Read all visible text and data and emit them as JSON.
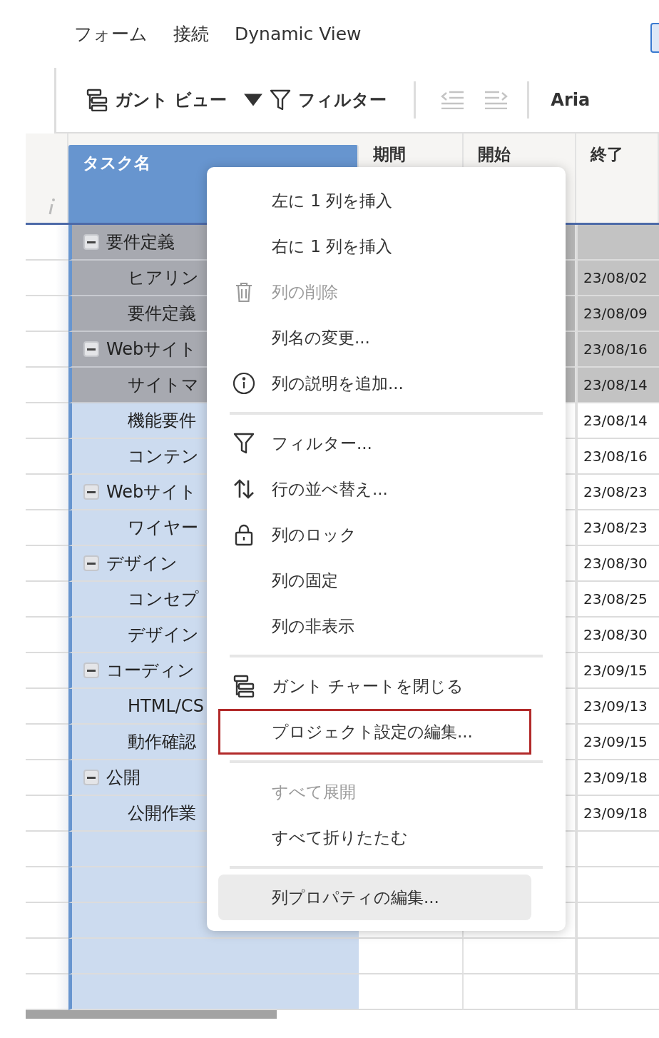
{
  "tabs": [
    {
      "label": "フォーム",
      "selected": false
    },
    {
      "label": "接続",
      "selected": false
    },
    {
      "label": "Dynamic View",
      "selected": false
    }
  ],
  "toolbar": {
    "items": [
      {
        "kind": "view",
        "label": "ガント ビュー"
      },
      {
        "kind": "filter",
        "label": "フィルター"
      },
      {
        "kind": "outdent",
        "disabled": true
      },
      {
        "kind": "indent",
        "disabled": true
      },
      {
        "kind": "font",
        "label": "Aria"
      }
    ]
  },
  "table": {
    "columns": [
      {
        "label": "タスク名",
        "selected": true
      },
      {
        "label": "期間",
        "selected": false
      },
      {
        "label": "開始",
        "selected": false
      },
      {
        "label": "終了",
        "selected": false
      }
    ],
    "rows": [
      {
        "name": "要件定義",
        "selected": true,
        "expanded": true,
        "children": [
          {
            "name": "ヒアリン",
            "end": "23/08/02",
            "selected": true
          },
          {
            "name": "要件定義",
            "end": "23/08/09",
            "selected": true
          }
        ]
      },
      {
        "name": "Webサイト",
        "end": "23/08/16",
        "selected": true,
        "expanded": true,
        "children": [
          {
            "name": "サイトマ",
            "end": "23/08/14",
            "selected": true
          },
          {
            "name": "機能要件",
            "end": "23/08/14",
            "selected": false
          },
          {
            "name": "コンテン",
            "end": "23/08/16",
            "selected": false
          }
        ]
      },
      {
        "name": "Webサイト",
        "end": "23/08/23",
        "selected": false,
        "expanded": true,
        "children": [
          {
            "name": "ワイヤー",
            "end": "23/08/23",
            "selected": false
          }
        ]
      },
      {
        "name": "デザイン",
        "end": "23/08/30",
        "selected": false,
        "expanded": true,
        "children": [
          {
            "name": "コンセプ",
            "end": "23/08/25",
            "selected": false
          },
          {
            "name": "デザイン",
            "end": "23/08/30",
            "selected": false
          }
        ]
      },
      {
        "name": "コーディン",
        "end": "23/09/15",
        "selected": false,
        "expanded": true,
        "children": [
          {
            "name": "HTML/CS",
            "end": "23/09/13",
            "selected": false
          },
          {
            "name": "動作確認",
            "end": "23/09/15",
            "selected": false
          }
        ]
      },
      {
        "name": "公開",
        "end": "23/09/18",
        "selected": false,
        "expanded": true,
        "children": [
          {
            "name": "公開作業",
            "end": "23/09/18",
            "selected": false
          }
        ]
      }
    ]
  },
  "context_menu": {
    "groups": [
      {
        "items": [
          {
            "kind": "plain",
            "label": "左に 1 列を挿入",
            "disabled": false,
            "focused": false,
            "selected": false
          },
          {
            "kind": "plain",
            "label": "右に 1 列を挿入",
            "disabled": false,
            "focused": false,
            "selected": false
          },
          {
            "kind": "delete",
            "label": "列の削除",
            "disabled": true,
            "focused": false,
            "selected": false
          },
          {
            "kind": "plain",
            "label": "列名の変更...",
            "disabled": false,
            "focused": false,
            "selected": false
          },
          {
            "kind": "describe",
            "label": "列の説明を追加...",
            "disabled": false,
            "focused": false,
            "selected": false
          }
        ]
      },
      {
        "items": [
          {
            "kind": "filter",
            "label": "フィルター...",
            "disabled": false,
            "focused": false,
            "selected": false
          },
          {
            "kind": "sort",
            "label": "行の並べ替え...",
            "disabled": false,
            "focused": false,
            "selected": false
          },
          {
            "kind": "lock",
            "label": "列のロック",
            "disabled": false,
            "focused": false,
            "selected": false
          },
          {
            "kind": "plain",
            "label": "列の固定",
            "disabled": false,
            "focused": false,
            "selected": false
          },
          {
            "kind": "plain",
            "label": "列の非表示",
            "disabled": false,
            "focused": false,
            "selected": false
          }
        ]
      },
      {
        "items": [
          {
            "kind": "gantt",
            "label": "ガント チャートを閉じる",
            "disabled": false,
            "focused": false,
            "selected": false
          },
          {
            "kind": "plain",
            "label": "プロジェクト設定の編集...",
            "disabled": false,
            "focused": true,
            "selected": false
          }
        ]
      },
      {
        "items": [
          {
            "kind": "plain",
            "label": "すべて展開",
            "disabled": true,
            "focused": false,
            "selected": false
          },
          {
            "kind": "plain",
            "label": "すべて折りたたむ",
            "disabled": false,
            "focused": false,
            "selected": false
          }
        ]
      },
      {
        "items": [
          {
            "kind": "plain",
            "label": "列プロパティの編集...",
            "disabled": false,
            "focused": false,
            "selected": true
          }
        ]
      }
    ]
  }
}
